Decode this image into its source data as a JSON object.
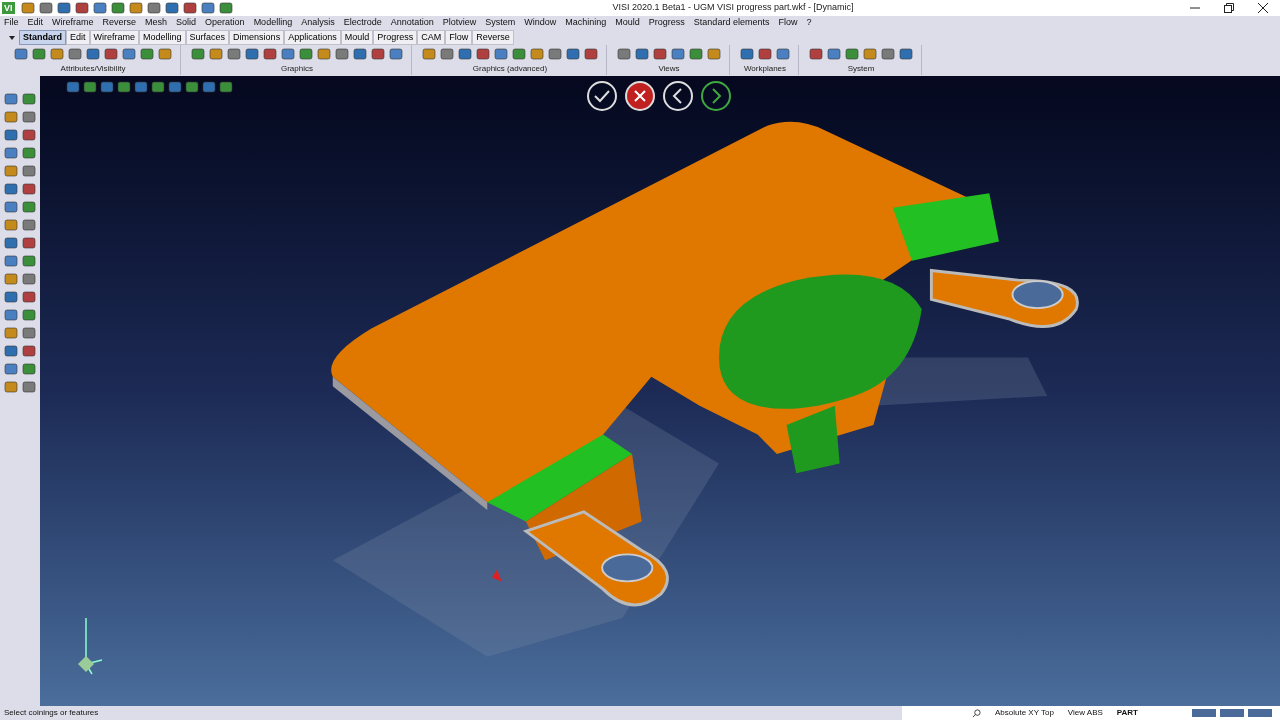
{
  "window": {
    "app_badge": "VI",
    "title": "VISI 2020.1 Beta1 - UGM VISI progress part.wkf - [Dynamic]"
  },
  "menu": [
    "File",
    "Edit",
    "Wireframe",
    "Reverse",
    "Mesh",
    "Solid",
    "Operation",
    "Modelling",
    "Analysis",
    "Electrode",
    "Annotation",
    "Plotview",
    "System",
    "Window",
    "Machining",
    "Mould",
    "Progress",
    "Standard elements",
    "Flow",
    "?"
  ],
  "tabs": [
    {
      "label": "Standard",
      "selected": true
    },
    {
      "label": "Edit",
      "selected": false
    },
    {
      "label": "Wireframe",
      "selected": false
    },
    {
      "label": "Modelling",
      "selected": false
    },
    {
      "label": "Surfaces",
      "selected": false
    },
    {
      "label": "Dimensions",
      "selected": false
    },
    {
      "label": "Applications",
      "selected": false
    },
    {
      "label": "Mould",
      "selected": false
    },
    {
      "label": "Progress",
      "selected": false
    },
    {
      "label": "CAM",
      "selected": false
    },
    {
      "label": "Flow",
      "selected": false
    },
    {
      "label": "Reverse",
      "selected": false
    }
  ],
  "toolbar_groups": [
    {
      "label": "Attributes/Visibility"
    },
    {
      "label": "Graphics"
    },
    {
      "label": "Graphics (advanced)"
    },
    {
      "label": "Views"
    },
    {
      "label": "Workplanes"
    },
    {
      "label": "System"
    }
  ],
  "status_bar": {
    "prompt": "Select coinings or features",
    "workplane": "Absolute XY Top",
    "view": "View ABS",
    "mode": "PART"
  }
}
